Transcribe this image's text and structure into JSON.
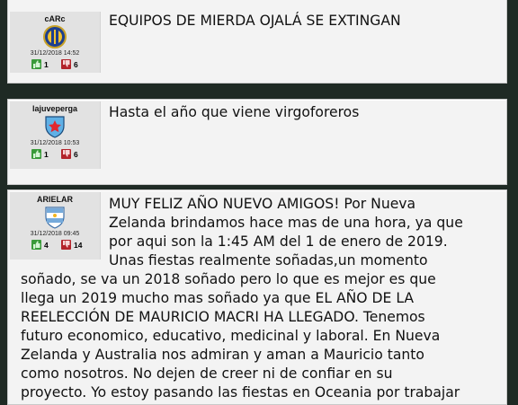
{
  "posts": [
    {
      "username": "cARc",
      "date": "31/12/2018 14:52",
      "likes": "1",
      "dislikes": "6",
      "badge_icon": "rosario-central-crest-icon",
      "message": "EQUIPOS DE MIERDA OJALÁ SE EXTINGAN"
    },
    {
      "username": "lajuveperga",
      "date": "31/12/2018 10:53",
      "likes": "1",
      "dislikes": "6",
      "badge_icon": "star-shield-icon",
      "message": "Hasta el año que viene virgoforeros"
    },
    {
      "username": "ARIELAR",
      "date": "31/12/2018 09:45",
      "likes": "4",
      "dislikes": "14",
      "badge_icon": "argentina-shield-icon",
      "message_lines_right": [
        "MUY FELIZ AÑO NUEVO AMIGOS! Por Nueva",
        "Zelanda brindamos hace mas de una hora, ya que",
        "por aqui son la 1:45 AM del 1 de enero de 2019.",
        "Unas fiestas realmente soñadas,un momento"
      ],
      "message_lines_full": [
        "soñado, se va un 2018 soñado pero lo que es mejor es que",
        "llega un 2019 mucho mas soñado ya que EL AÑO DE LA",
        "REELECCIÓN DE MAURICIO MACRI HA LLEGADO. Tenemos",
        "futuro economico, educativo, medicinal y laboral. En Nueva",
        "Zelanda y Australia nos admiran y aman a Mauricio tanto",
        "como nosotros. No dejen de creer ni de confiar en su",
        "proyecto. Yo estoy pasando las fiestas en Oceania por trabajar"
      ]
    }
  ],
  "colors": {
    "page_background": "#1f2a24",
    "card_background": "#f3f3f3",
    "user_panel": "#e2e2e2",
    "like_green": "#3a9a3a",
    "dislike_red": "#b3232a"
  }
}
